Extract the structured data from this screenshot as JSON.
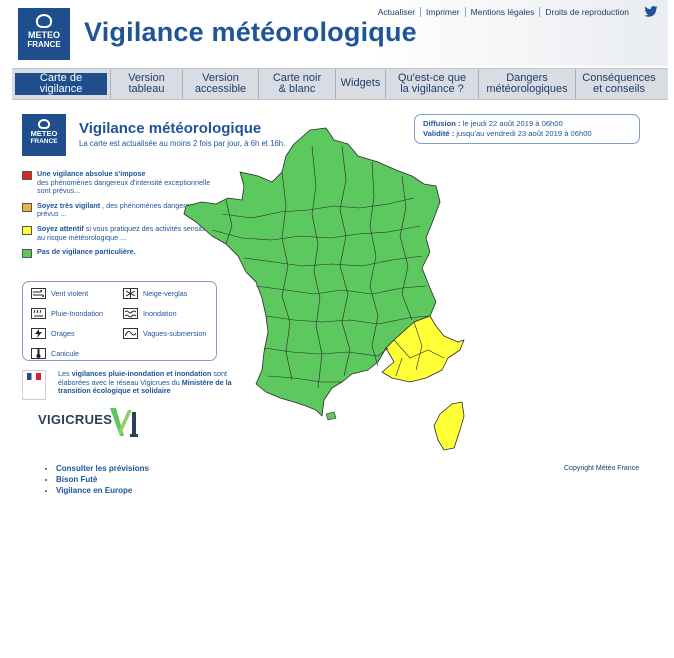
{
  "header": {
    "logo_line1": "METEO",
    "logo_line2": "FRANCE",
    "title": "Vigilance météorologique",
    "top_links": [
      "Actualiser",
      "Imprimer",
      "Mentions légales",
      "Droits de reproduction"
    ],
    "twitter_icon": "twitter-bird-icon"
  },
  "nav": {
    "tabs": [
      {
        "line1": "Carte de vigilance",
        "line2": "",
        "active": true
      },
      {
        "line1": "Version",
        "line2": "tableau"
      },
      {
        "line1": "Version",
        "line2": "accessible"
      },
      {
        "line1": "Carte noir",
        "line2": "& blanc"
      },
      {
        "line1": "Widgets",
        "line2": ""
      },
      {
        "line1": "Qu'est-ce que",
        "line2": "la vigilance ?"
      },
      {
        "line1": "Dangers",
        "line2": "météorologiques"
      },
      {
        "line1": "Conséquences",
        "line2": "et conseils"
      }
    ]
  },
  "map_header": {
    "logo_line1": "METEO",
    "logo_line2": "FRANCE",
    "title": "Vigilance météorologique",
    "subtitle": "La carte est actualisée au moins 2 fois par jour, à 6h et 16h."
  },
  "diffusion": {
    "label1": "Diffusion :",
    "value1": " le jeudi 22 août 2019 à 06h00",
    "label2": "Validité :",
    "value2": " jusqu'au vendredi 23 août 2019 à 06h00"
  },
  "legend": {
    "red": {
      "bold": "Une vigilance absolue s'impose",
      "text": "des phénomènes dangereux d'intensité exceptionnelle sont prévus..."
    },
    "orange": {
      "bold": "Soyez très vigilant",
      "text": " , des phénomènes dangereux sont prévus ..."
    },
    "yellow": {
      "bold": "Soyez attentif",
      "text": " si vous pratiquez des activités sensibles au risque météorologique ..."
    },
    "green": {
      "bold": "Pas de vigilance particulière.",
      "text": ""
    }
  },
  "colors": {
    "red": "#e0261c",
    "orange": "#f0b23c",
    "yellow": "#ffff37",
    "green": "#5cc85e",
    "navy": "#1f4e8c"
  },
  "phenomena": [
    {
      "label": "Vent violent",
      "icon": "wind-icon"
    },
    {
      "label": "Neige-verglas",
      "icon": "snow-icon"
    },
    {
      "label": "Pluie-Inondation",
      "icon": "rain-icon"
    },
    {
      "label": "Inondation",
      "icon": "flood-icon"
    },
    {
      "label": "Orages",
      "icon": "lightning-icon"
    },
    {
      "label": "Vagues-submersion",
      "icon": "wave-icon"
    },
    {
      "label": "Canicule",
      "icon": "thermometer-icon"
    }
  ],
  "ministry": {
    "line1": "Les ",
    "bold1": "vigilances pluie-inondation et inondation",
    "line2": " sont élaborées avec le réseau Vigicrues du ",
    "bold2": "Ministère de la transition écologique et solidaire"
  },
  "vigicrues": "VIGICRUES",
  "links": [
    "Consulter les prévisions",
    "Bison Futé",
    "Vigilance en Europe"
  ],
  "copyright": "Copyright Météo France"
}
